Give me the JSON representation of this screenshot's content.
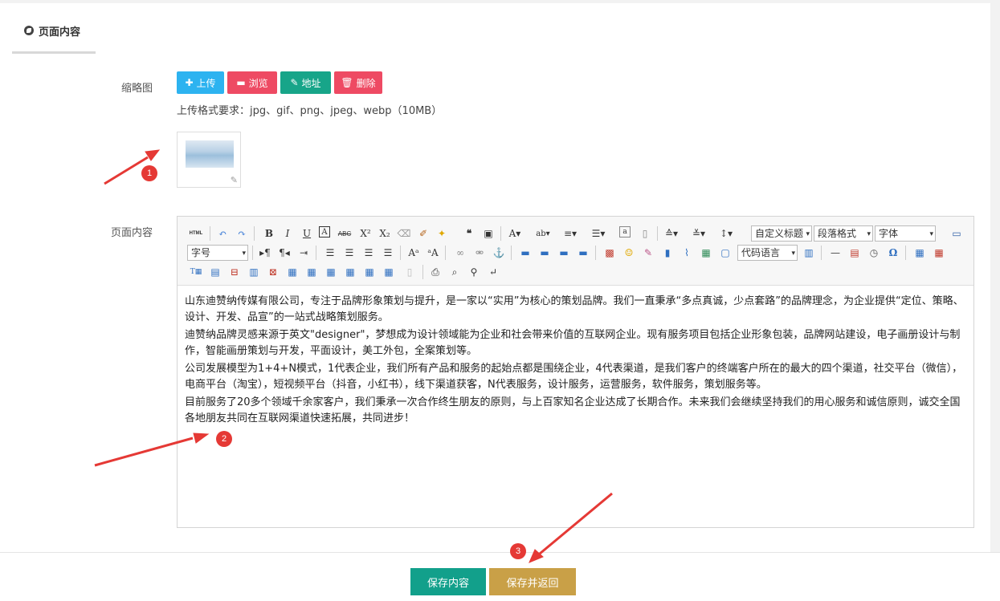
{
  "tab": {
    "label": "页面内容"
  },
  "thumbnail": {
    "label": "缩略图",
    "buttons": {
      "upload": "上传",
      "browse": "浏览",
      "address": "地址",
      "delete": "删除"
    },
    "hint": "上传格式要求：jpg、gif、png、jpeg、webp（10MB）"
  },
  "content": {
    "label": "页面内容",
    "toolbar": {
      "custom_title": "自定义标题",
      "paragraph_format": "段落格式",
      "font": "字体",
      "font_size": "字号",
      "code_lang": "代码语言",
      "html_btn": "HTML"
    },
    "paragraphs": [
      "山东迪赞纳传媒有限公司，专注于品牌形象策划与提升，是一家以“实用”为核心的策划品牌。我们一直秉承“多点真诚，少点套路”的品牌理念，为企业提供“定位、策略、设计、开发、品宣”的一站式战略策划服务。",
      "迪赞纳品牌灵感来源于英文\"designer\"，梦想成为设计领域能为企业和社会带来价值的互联网企业。现有服务项目包括企业形象包装，品牌网站建设，电子画册设计与制作，智能画册策划与开发，平面设计，美工外包，全案策划等。",
      "公司发展模型为1+4+N模式，1代表企业，我们所有产品和服务的起始点都是围绕企业，4代表渠道，是我们客户的终端客户所在的最大的四个渠道，社交平台（微信），电商平台（淘宝），短视频平台（抖音，小红书），线下渠道获客，N代表服务，设计服务，运营服务，软件服务，策划服务等。",
      "目前服务了20多个领域千余家客户，我们秉承一次合作终生朋友的原则，与上百家知名企业达成了长期合作。未来我们会继续坚持我们的用心服务和诚信原则，诚交全国各地朋友共同在互联网渠道快速拓展，共同进步！"
    ]
  },
  "footer": {
    "save": "保存内容",
    "save_return": "保存并返回"
  },
  "markers": [
    "1",
    "2",
    "3"
  ],
  "colors": {
    "upload": "#2db3f0",
    "danger": "#ee4a63",
    "teal": "#17a589",
    "gold": "#c9a047",
    "marker": "#e53935"
  }
}
